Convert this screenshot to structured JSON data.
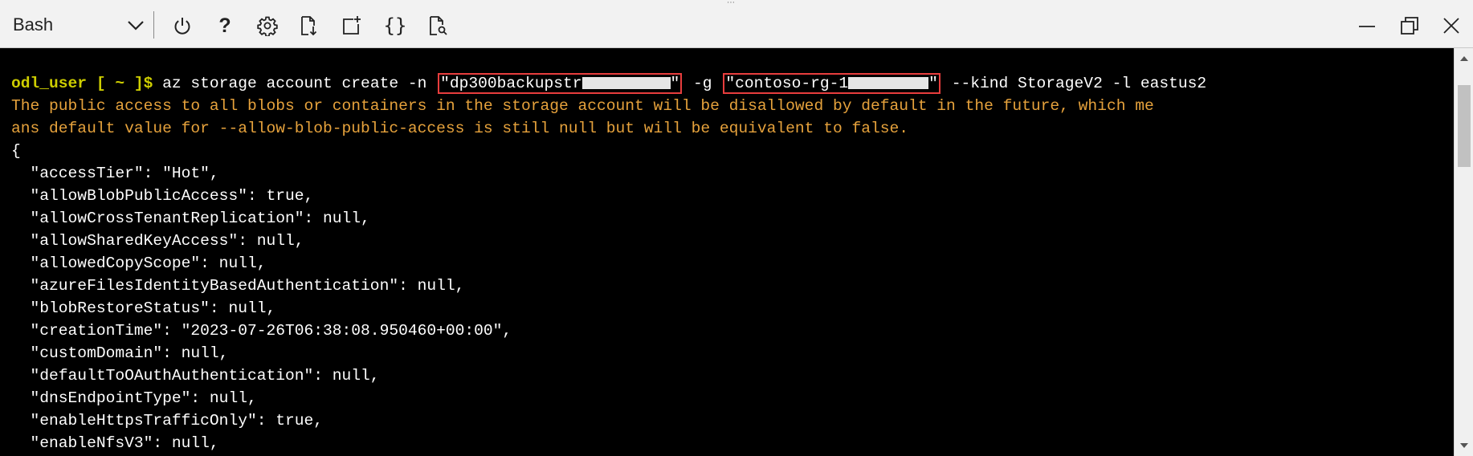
{
  "toolbar": {
    "shell": "Bash",
    "grip": "⋯",
    "help_glyph": "?",
    "braces_glyph": "{}"
  },
  "terminal": {
    "prompt": "odl_user [ ~ ]$",
    "cmd_pre": " az storage account create -n ",
    "name_arg": "\"dp300backupstr",
    "name_end": "\"",
    "cmd_mid": " -g ",
    "rg_arg": "\"contoso-rg-1",
    "rg_end": "\"",
    "cmd_post": " --kind StorageV2 -l eastus2",
    "warn_line1": "The public access to all blobs or containers in the storage account will be disallowed by default in the future, which me",
    "warn_line2": "ans default value for --allow-blob-public-access is still null but will be equivalent to false.",
    "output": [
      "{",
      "  \"accessTier\": \"Hot\",",
      "  \"allowBlobPublicAccess\": true,",
      "  \"allowCrossTenantReplication\": null,",
      "  \"allowSharedKeyAccess\": null,",
      "  \"allowedCopyScope\": null,",
      "  \"azureFilesIdentityBasedAuthentication\": null,",
      "  \"blobRestoreStatus\": null,",
      "  \"creationTime\": \"2023-07-26T06:38:08.950460+00:00\",",
      "  \"customDomain\": null,",
      "  \"defaultToOAuthAuthentication\": null,",
      "  \"dnsEndpointType\": null,",
      "  \"enableHttpsTrafficOnly\": true,",
      "  \"enableNfsV3\": null,"
    ]
  },
  "colors": {
    "terminal_bg": "#000000",
    "prompt": "#cdcd00",
    "warning": "#e6a23c",
    "highlight_box": "#e83d3d",
    "toolbar_bg": "#f2f2f2"
  }
}
